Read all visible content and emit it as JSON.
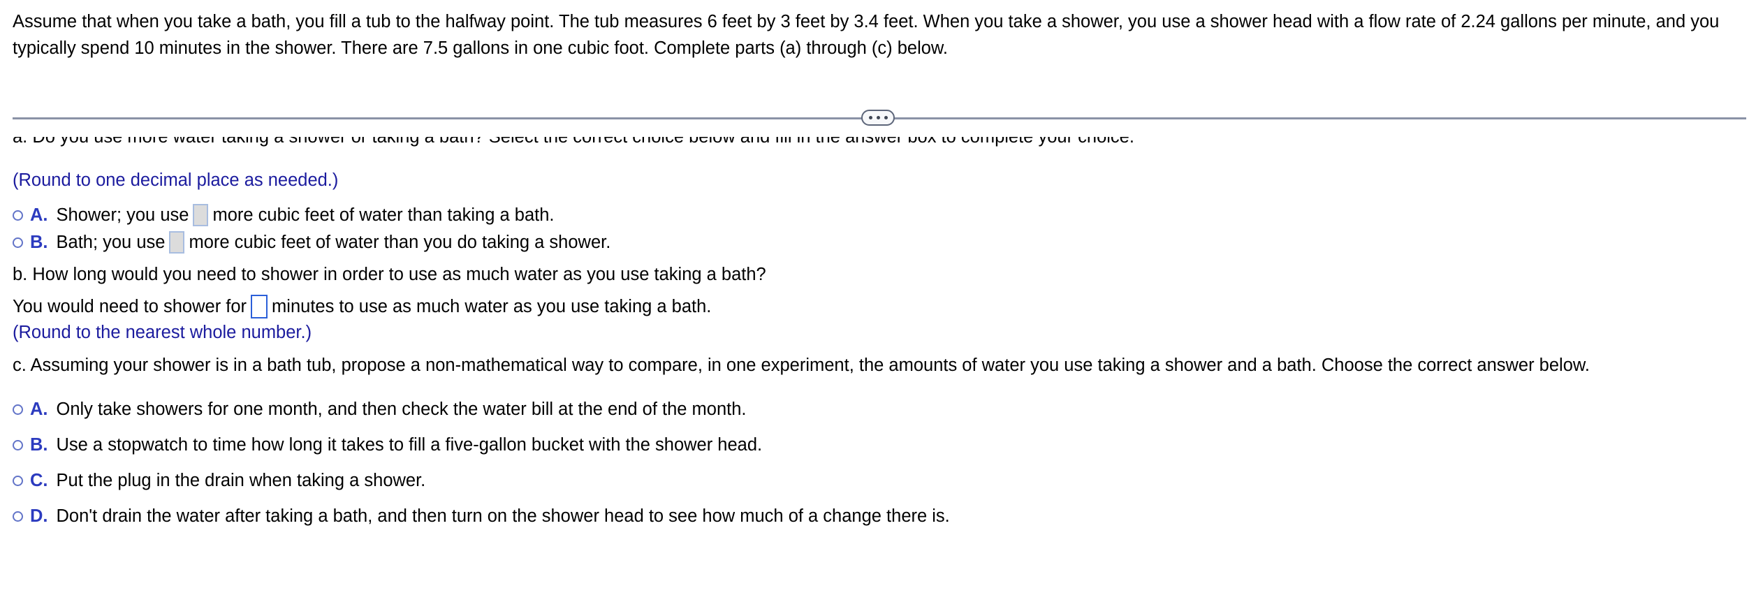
{
  "problem": {
    "statement": "Assume that when you take a bath, you fill a tub to the halfway point. The tub measures 6 feet by 3 feet by 3.4 feet. When you take a shower, you use a shower head with a flow rate of 2.24 gallons per minute, and you typically spend 10 minutes in the shower. There are 7.5 gallons in one cubic foot. Complete parts (a) through (c) below."
  },
  "divider": {
    "expand_label": "…",
    "line_color": "#8a92a6",
    "pill_border_color": "#5c6579"
  },
  "part_a": {
    "prompt": "a. Do you use more water taking a shower or taking a bath? Select the correct choice below and fill in the answer box to complete your choice.",
    "rounding_note": "(Round to one decimal place as needed.)",
    "choices": [
      {
        "letter": "A.",
        "text_before": "Shower; you use",
        "answer_value": "",
        "text_after": "more cubic feet of water than taking a bath.",
        "box_state": "disabled"
      },
      {
        "letter": "B.",
        "text_before": "Bath; you use",
        "answer_value": "",
        "text_after": "more cubic feet of water than you do taking a shower.",
        "box_state": "disabled"
      }
    ]
  },
  "part_b": {
    "prompt": "b. How long would you need to shower in order to use as much water as you use taking a bath?",
    "sentence_before": "You would need to shower for",
    "answer_value": "",
    "sentence_after": "minutes to use as much water as you use taking a bath.",
    "rounding_note": "(Round to the nearest whole number.)",
    "box_state": "active"
  },
  "part_c": {
    "prompt": "c. Assuming your shower is in a bath tub, propose a non-mathematical way to compare, in one experiment, the amounts of water you use taking a shower and a bath. Choose the correct answer below.",
    "choices": [
      {
        "letter": "A.",
        "text": "Only take showers for one month, and then check the water bill at the end of the month."
      },
      {
        "letter": "B.",
        "text": "Use a stopwatch to time how long it takes to fill a five-gallon bucket with the shower head."
      },
      {
        "letter": "C.",
        "text": "Put the plug in the drain when taking a shower."
      },
      {
        "letter": "D.",
        "text": "Don't drain the water after taking a bath, and then turn on the shower head to see how much of a change there is."
      }
    ]
  },
  "colors": {
    "note_blue": "#1b1b9e",
    "letter_blue": "#2c3bbf",
    "radio_blue": "#6274c8",
    "active_box_blue": "#2b5fd9",
    "disabled_box_fill": "#dcdcdc"
  }
}
